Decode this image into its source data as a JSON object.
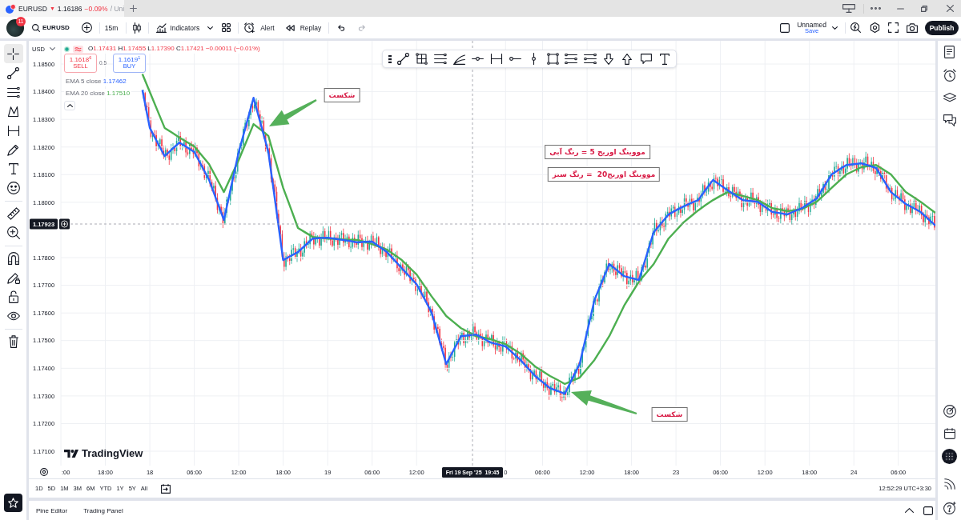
{
  "titlebar": {
    "tabs": [
      {
        "symbol": "EURUSD",
        "falling": true,
        "arrow": "▼",
        "price": "1.16186",
        "change": "−0.09%",
        "suffix": "/ Uni",
        "selected": true
      }
    ]
  },
  "toolbar": {
    "notifications": "11",
    "symbol": "EURUSD",
    "interval": "15m",
    "indicators": "Indicators",
    "alert": "Alert",
    "replay": "Replay",
    "undo": {
      "disabled": false
    },
    "redo": {
      "disabled": true
    },
    "layout_name": "Unnamed",
    "layout_status": "Save",
    "publish": "Publish"
  },
  "left_toolbar": {
    "groups": [
      [
        {
          "selected": true
        },
        {
          "selected": false
        },
        {
          "selected": false
        },
        {
          "selected": false
        },
        {
          "selected": false
        },
        {
          "selected": false
        },
        {
          "selected": false
        },
        {
          "selected": false
        }
      ],
      [
        {
          "selected": false
        },
        {
          "selected": false
        }
      ],
      [
        {
          "selected": false
        },
        {
          "selected": false
        },
        {
          "selected": false
        },
        {
          "selected": false
        }
      ],
      [
        {
          "selected": false
        }
      ]
    ]
  },
  "chart": {
    "currency": "USD",
    "legend": {
      "falling": true,
      "ohlc": [
        {
          "label": "O",
          "value": "1.17431"
        },
        {
          "label": "H",
          "value": "1.17455"
        },
        {
          "label": "L",
          "value": "1.17390"
        },
        {
          "label": "C",
          "value": "1.17421"
        }
      ],
      "change": "−0.00011 (−0.01%)"
    },
    "sell": {
      "price": "1.1618$^{6}$",
      "label": "SELL"
    },
    "spread": "0.5",
    "buy": {
      "price": "1.1619$^{1}$",
      "label": "BUY"
    },
    "indicator_values": [
      "1.17462",
      "1.17510"
    ],
    "chart_data": {
      "type": "line",
      "categories": [
        ":00",
        null,
        null,
        null,
        null,
        null,
        "18:00",
        null,
        null,
        null,
        null,
        null,
        "18",
        null,
        null,
        null,
        null,
        null,
        "06:00",
        null,
        null,
        null,
        null,
        null,
        "12:00",
        null,
        null,
        null,
        null,
        null,
        "18:00",
        null,
        null,
        null,
        null,
        null,
        "19",
        null,
        null,
        null,
        null,
        null,
        "06:00",
        null,
        null,
        null,
        null,
        null,
        "12:00",
        null,
        null,
        null,
        null,
        null,
        null,
        null,
        null,
        null,
        null,
        null,
        "0",
        null,
        null,
        null,
        null,
        "06:00",
        null,
        null,
        null,
        null,
        null,
        "12:00",
        null,
        null,
        null,
        null,
        null,
        "18:00",
        null,
        null,
        null,
        null,
        null,
        "23",
        null,
        null,
        null,
        null,
        null,
        "06:00",
        null,
        null,
        null,
        null,
        null,
        "12:00",
        null,
        null,
        null,
        null,
        null,
        "18:00",
        null,
        null,
        null,
        null,
        null,
        "24",
        null,
        null,
        null,
        null,
        null,
        "06:00",
        null,
        null,
        null,
        null,
        null
      ],
      "series": [
        {
          "name": "EMA 5 close",
          "color": "#2962ff",
          "values": [
            null,
            null,
            null,
            null,
            null,
            null,
            null,
            null,
            null,
            null,
            null,
            1.18406,
            1.18269,
            1.18218,
            1.18167,
            1.18192,
            1.18216,
            1.18199,
            1.18182,
            1.18132,
            1.18081,
            1.18009,
            1.17936,
            1.18059,
            1.18182,
            1.1828,
            1.18378,
            1.1828,
            1.18182,
            1.17987,
            1.17791,
            1.17806,
            1.1782,
            1.17845,
            1.17869,
            1.17871,
            1.17872,
            1.17868,
            1.17864,
            1.1786,
            1.17855,
            1.17857,
            1.17858,
            1.17839,
            1.1782,
            1.17791,
            1.17762,
            1.17733,
            1.17704,
            1.17654,
            1.17603,
            1.17509,
            1.17415,
            1.17466,
            1.17516,
            1.17519,
            1.17522,
            1.17508,
            1.17493,
            1.17486,
            1.17479,
            1.17455,
            1.1743,
            1.17401,
            1.17372,
            1.1735,
            1.17328,
            1.17318,
            1.17308,
            1.17362,
            1.17415,
            1.17531,
            1.17647,
            1.17712,
            1.17777,
            1.17755,
            1.17733,
            1.17726,
            1.17719,
            1.17806,
            1.17892,
            1.17924,
            1.17956,
            1.17971,
            1.17985,
            1.17997,
            1.18008,
            1.18045,
            1.18081,
            1.18062,
            1.18043,
            1.18026,
            1.18008,
            1.18005,
            1.18002,
            1.17984,
            1.17965,
            1.17961,
            1.17956,
            1.17968,
            1.17979,
            1.17997,
            1.18014,
            1.18058,
            1.18101,
            1.18118,
            1.18135,
            1.18138,
            1.18141,
            1.18133,
            1.18124,
            1.18081,
            1.18037,
            1.18016,
            1.17994,
            1.1798,
            1.17965,
            1.17941,
            1.17916
          ]
        },
        {
          "name": "EMA 20 close",
          "color": "#4caf50",
          "values": [
            null,
            null,
            null,
            null,
            null,
            null,
            null,
            null,
            null,
            null,
            null,
            1.18464,
            1.18399,
            1.18334,
            1.18269,
            1.18252,
            1.18234,
            1.18218,
            1.18202,
            1.1817,
            1.18138,
            1.18088,
            1.18037,
            1.18095,
            1.18153,
            1.18218,
            1.18283,
            1.18262,
            1.1824,
            1.18146,
            1.18052,
            1.1798,
            1.17907,
            1.17891,
            1.17875,
            1.17872,
            1.17869,
            1.17868,
            1.17866,
            1.17865,
            1.17864,
            1.17857,
            1.17849,
            1.17839,
            1.17829,
            1.1781,
            1.17791,
            1.17765,
            1.17739,
            1.177,
            1.17661,
            1.17625,
            1.17589,
            1.17567,
            1.17545,
            1.17531,
            1.17516,
            1.17511,
            1.17505,
            1.17496,
            1.17487,
            1.1747,
            1.17453,
            1.1743,
            1.17406,
            1.17389,
            1.17372,
            1.17358,
            1.17343,
            1.17355,
            1.17366,
            1.17398,
            1.1743,
            1.17473,
            1.17516,
            1.17571,
            1.17626,
            1.1767,
            1.17713,
            1.17745,
            1.17777,
            1.17823,
            1.17869,
            1.17898,
            1.17927,
            1.17949,
            1.17971,
            1.1799,
            1.18008,
            1.18023,
            1.18037,
            1.1803,
            1.18023,
            1.18016,
            1.18008,
            1.17994,
            1.17979,
            1.17974,
            1.17968,
            1.17972,
            1.17976,
            1.17989,
            1.18002,
            1.18027,
            1.18052,
            1.18077,
            1.18101,
            1.18114,
            1.18127,
            1.18131,
            1.18135,
            1.18118,
            1.18101,
            1.18069,
            1.18037,
            1.1802,
            1.18002,
            1.17982,
            1.17962
          ]
        }
      ],
      "ylim": [
        1.17048,
        1.18584
      ],
      "yticks": [
        {
          "value": 1.185,
          "label": "1.18500"
        },
        {
          "value": 1.184,
          "label": "1.18400"
        },
        {
          "value": 1.183,
          "label": "1.18300"
        },
        {
          "value": 1.182,
          "label": "1.18200"
        },
        {
          "value": 1.181,
          "label": "1.18100"
        },
        {
          "value": 1.18,
          "label": "1.18000"
        },
        {
          "value": 1.178,
          "label": "1.17800"
        },
        {
          "value": 1.177,
          "label": "1.17700"
        },
        {
          "value": 1.176,
          "label": "1.17600"
        },
        {
          "value": 1.175,
          "label": "1.17500"
        },
        {
          "value": 1.174,
          "label": "1.17400"
        },
        {
          "value": 1.173,
          "label": "1.17300"
        },
        {
          "value": 1.172,
          "label": "1.17200"
        },
        {
          "value": 1.171,
          "label": "1.17100"
        }
      ],
      "grid": true,
      "annotations": [
        "شکست",
        "مووینگ اوریج 5 = رنگ آبی",
        "مووینگ اوریج20  = رنگ سبز",
        "شکست"
      ]
    },
    "crosshair": {
      "price": "1.17923",
      "time": "Fri 19 Sep '25  19:45"
    },
    "branding": "TradingView",
    "timeframes": [
      "1D",
      "5D",
      "1M",
      "3M",
      "6M",
      "YTD",
      "1Y",
      "5Y",
      "All"
    ],
    "clock": "12:52:29 UTC+3:30"
  },
  "bottom_panel": {
    "tabs": [
      "Pine Editor",
      "Trading Panel"
    ]
  }
}
